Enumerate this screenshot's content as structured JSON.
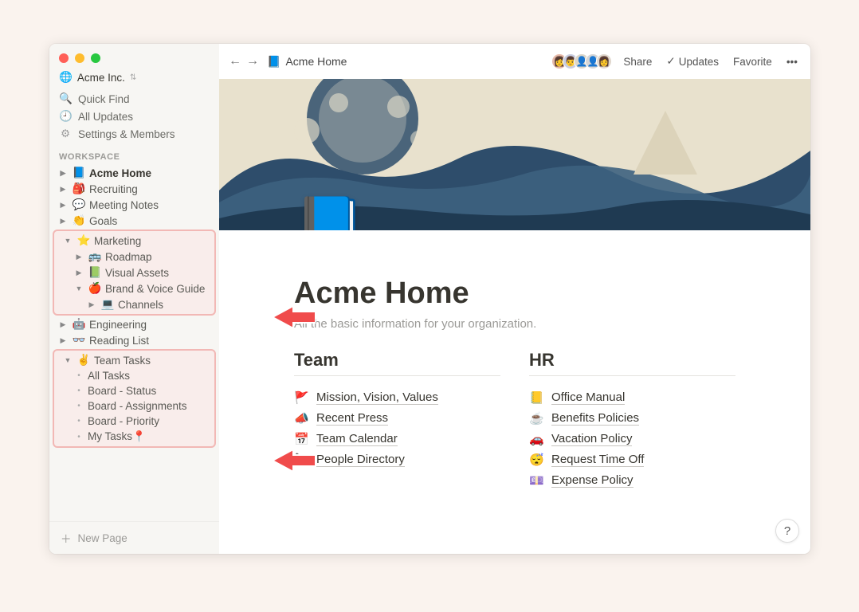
{
  "workspace": {
    "icon": "🌐",
    "name": "Acme Inc."
  },
  "sidebar": {
    "quick_find": "Quick Find",
    "all_updates": "All Updates",
    "settings_members": "Settings & Members",
    "section_label": "WORKSPACE",
    "new_page": "New Page",
    "pages": {
      "acme_home": "Acme Home",
      "recruiting": "Recruiting",
      "meeting_notes": "Meeting Notes",
      "goals": "Goals",
      "marketing": "Marketing",
      "roadmap": "Roadmap",
      "visual_assets": "Visual Assets",
      "brand_voice": "Brand & Voice Guide",
      "channels": "Channels",
      "engineering": "Engineering",
      "reading_list": "Reading List",
      "team_tasks": "Team Tasks",
      "all_tasks": "All Tasks",
      "board_status": "Board - Status",
      "board_assignments": "Board - Assignments",
      "board_priority": "Board - Priority",
      "my_tasks": "My Tasks📍"
    }
  },
  "topbar": {
    "breadcrumb_icon": "📘",
    "breadcrumb": "Acme Home",
    "share": "Share",
    "updates": "Updates",
    "favorite": "Favorite"
  },
  "page": {
    "icon": "📘",
    "title": "Acme Home",
    "description": "All the basic information for your organization."
  },
  "columns": {
    "team": {
      "heading": "Team",
      "items": [
        {
          "emoji": "🚩",
          "label": "Mission, Vision, Values"
        },
        {
          "emoji": "📣",
          "label": "Recent Press"
        },
        {
          "emoji": "📅",
          "label": "Team Calendar"
        },
        {
          "emoji": "📞",
          "label": "People Directory"
        }
      ]
    },
    "hr": {
      "heading": "HR",
      "items": [
        {
          "emoji": "📒",
          "label": "Office Manual"
        },
        {
          "emoji": "☕",
          "label": "Benefits Policies"
        },
        {
          "emoji": "🚗",
          "label": "Vacation Policy"
        },
        {
          "emoji": "😴",
          "label": "Request Time Off"
        },
        {
          "emoji": "💷",
          "label": "Expense Policy"
        }
      ]
    }
  },
  "help": "?"
}
